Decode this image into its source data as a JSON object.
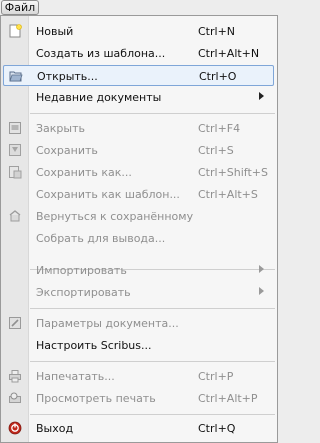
{
  "menubar": {
    "file_label": "Файл"
  },
  "menu": {
    "items": [
      {
        "label": "Новый",
        "shortcut": "Ctrl+N",
        "icon": "new-document-icon"
      },
      {
        "label": "Создать из шаблона...",
        "shortcut": "Ctrl+Alt+N"
      },
      {
        "label": "Открыть...",
        "shortcut": "Ctrl+O",
        "icon": "folder-open-icon"
      },
      {
        "label": "Недавние документы",
        "shortcut": ""
      },
      {
        "label": "Закрыть",
        "shortcut": "Ctrl+F4",
        "icon": "close-doc-icon"
      },
      {
        "label": "Сохранить",
        "shortcut": "Ctrl+S",
        "icon": "save-icon"
      },
      {
        "label": "Сохранить как...",
        "shortcut": "Ctrl+Shift+S",
        "icon": "save-as-icon"
      },
      {
        "label": "Сохранить как шаблон...",
        "shortcut": "Ctrl+Alt+S"
      },
      {
        "label": "Вернуться к сохранённому",
        "shortcut": "",
        "icon": "revert-icon"
      },
      {
        "label": "Собрать для вывода...",
        "shortcut": ""
      },
      {
        "label": "Импортировать",
        "shortcut": ""
      },
      {
        "label": "Экспортировать",
        "shortcut": ""
      },
      {
        "label": "Параметры документа...",
        "shortcut": "",
        "icon": "document-settings-icon"
      },
      {
        "label": "Настроить Scribus...",
        "shortcut": ""
      },
      {
        "label": "Напечатать...",
        "shortcut": "Ctrl+P",
        "icon": "print-icon"
      },
      {
        "label": "Просмотреть печать",
        "shortcut": "Ctrl+Alt+P",
        "icon": "print-preview-icon"
      },
      {
        "label": "Выход",
        "shortcut": "Ctrl+Q",
        "icon": "exit-icon"
      }
    ]
  },
  "colors": {
    "highlight": "#eaf2fb",
    "highlight_border": "#7fa6d8",
    "exit_icon": "#c0281c"
  }
}
